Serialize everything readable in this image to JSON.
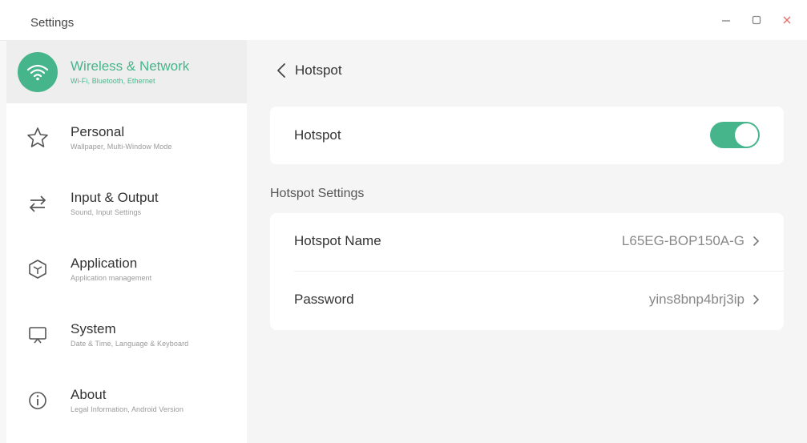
{
  "window": {
    "title": "Settings",
    "minimize_icon": "minus-icon",
    "maximize_icon": "square-icon",
    "close_icon": "close-icon",
    "close_color": "#e57373"
  },
  "accent_color": "#47b58c",
  "sidebar": {
    "items": [
      {
        "title": "Wireless & Network",
        "subtitle": "Wi-Fi, Bluetooth, Ethernet",
        "icon": "wifi-icon",
        "active": true
      },
      {
        "title": "Personal",
        "subtitle": "Wallpaper, Multi-Window Mode",
        "icon": "star-icon",
        "active": false
      },
      {
        "title": "Input & Output",
        "subtitle": "Sound, Input Settings",
        "icon": "swap-arrows-icon",
        "active": false
      },
      {
        "title": "Application",
        "subtitle": "Application management",
        "icon": "hexagon-icon",
        "active": false
      },
      {
        "title": "System",
        "subtitle": "Date & Time, Language & Keyboard",
        "icon": "monitor-icon",
        "active": false
      },
      {
        "title": "About",
        "subtitle": "Legal Information, Android Version",
        "icon": "info-icon",
        "active": false
      }
    ]
  },
  "main": {
    "back_label": "Hotspot",
    "hotspot_toggle": {
      "label": "Hotspot",
      "state": "on"
    },
    "section_title": "Hotspot Settings",
    "settings": [
      {
        "label": "Hotspot Name",
        "value": "L65EG-BOP150A-G"
      },
      {
        "label": "Password",
        "value": "yins8bnp4brj3ip"
      }
    ]
  }
}
